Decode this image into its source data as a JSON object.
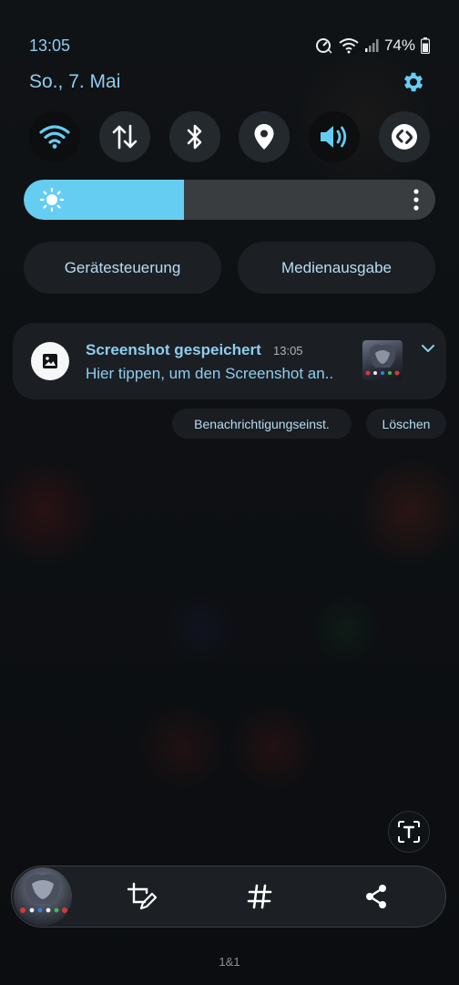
{
  "status_bar": {
    "time": "13:05",
    "battery": "74%",
    "icons": [
      "nfc-icon",
      "wifi-icon",
      "signal-icon",
      "battery-icon"
    ]
  },
  "header": {
    "date": "So., 7. Mai",
    "settings_icon": "gear-icon"
  },
  "quick_settings": [
    {
      "name": "wifi",
      "icon": "wifi-icon",
      "active": true
    },
    {
      "name": "mobile-data",
      "icon": "data-arrows-icon",
      "active": false
    },
    {
      "name": "bluetooth",
      "icon": "bluetooth-icon",
      "active": false
    },
    {
      "name": "location",
      "icon": "location-pin-icon",
      "active": false
    },
    {
      "name": "sound",
      "icon": "speaker-icon",
      "active": true
    },
    {
      "name": "shazam",
      "icon": "shazam-icon",
      "active": false
    }
  ],
  "brightness": {
    "level": 0.39,
    "icon": "sun-icon"
  },
  "panels": {
    "device_control": "Gerätesteuerung",
    "media_output": "Medienausgabe"
  },
  "notification": {
    "title": "Screenshot gespeichert",
    "time": "13:05",
    "body": "Hier tippen, um den Screenshot an..",
    "icon": "image-icon"
  },
  "notification_actions": {
    "settings": "Benachrichtigungseinst.",
    "clear": "Löschen"
  },
  "screenshot_toolbar": {
    "icons": [
      "crop-edit-icon",
      "hashtag-icon",
      "share-icon"
    ]
  },
  "carrier": "1&1",
  "colors": {
    "accent": "#8ecdf0",
    "brightness_fill": "#66cdf2",
    "background": "#0d0f12"
  }
}
